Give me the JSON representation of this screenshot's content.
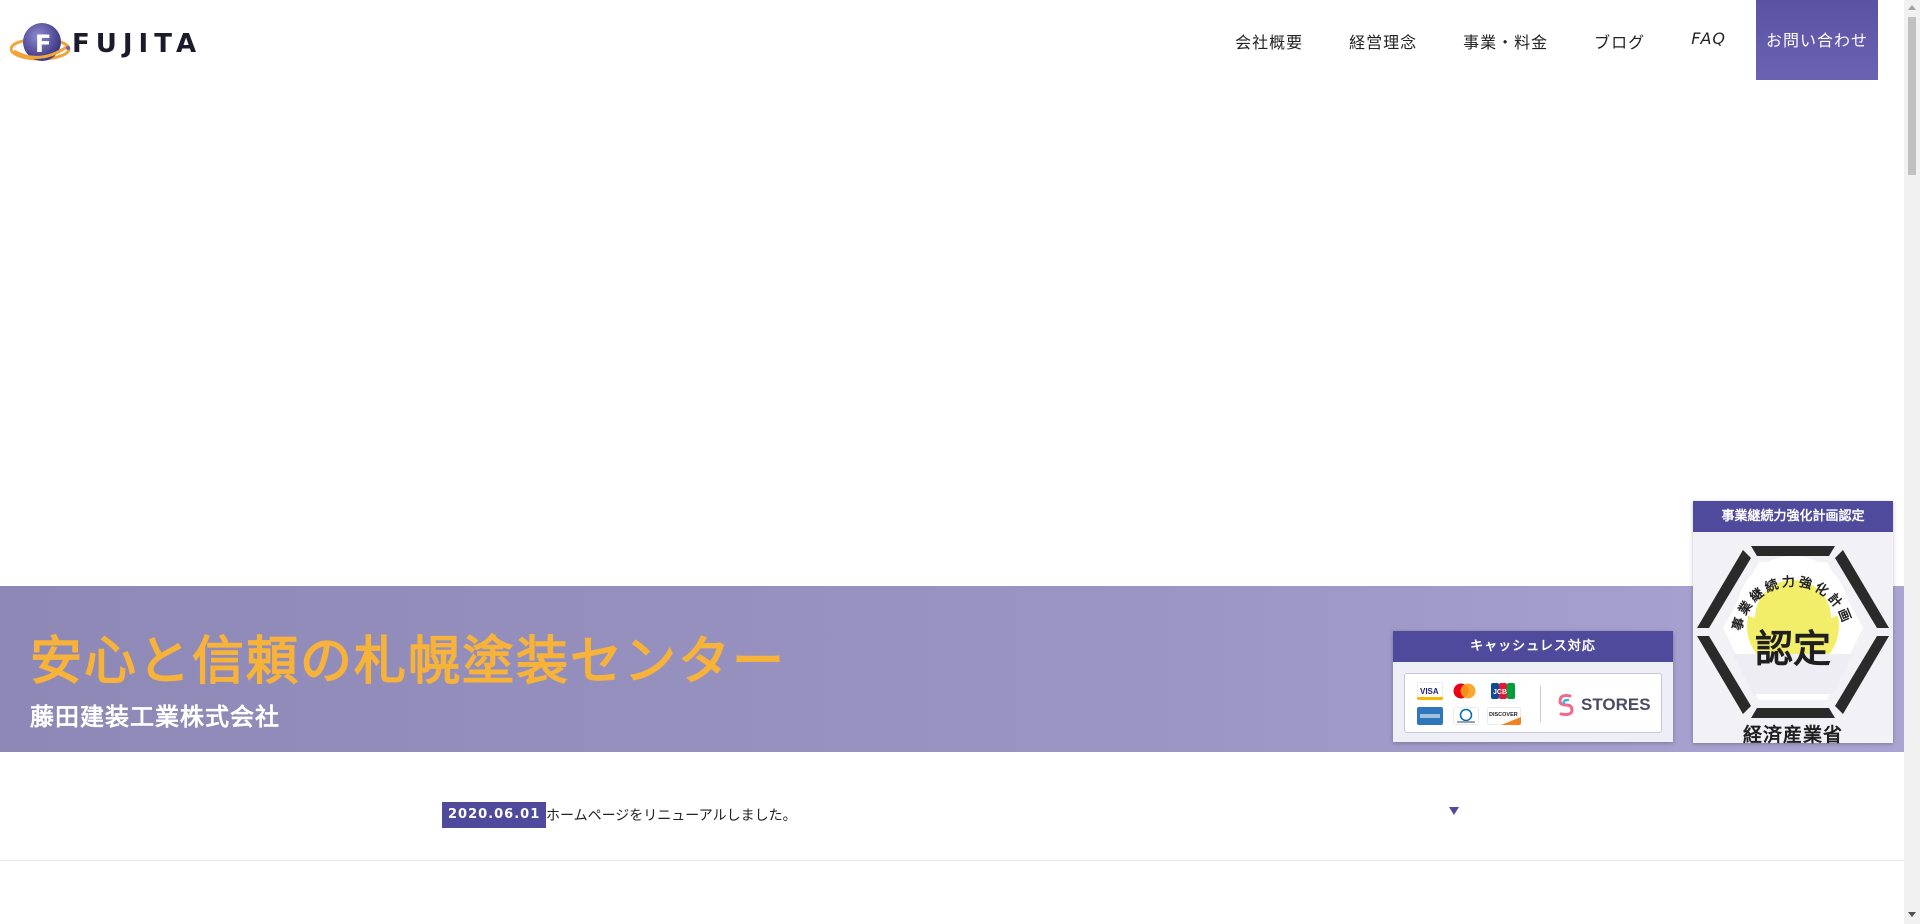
{
  "header": {
    "logo_text": "FUJITA",
    "logo_letter": "F",
    "nav": [
      {
        "label": "会社概要"
      },
      {
        "label": "経営理念"
      },
      {
        "label": "事業・料金"
      },
      {
        "label": "ブログ"
      },
      {
        "label": "FAQ"
      }
    ],
    "contact_label": "お問い合わせ"
  },
  "hero": {
    "title": "安心と信頼の札幌塗装センター",
    "subtitle": "藤田建装工業株式会社"
  },
  "cashless": {
    "title": "キャッシュレス対応",
    "stores_label": "STORES",
    "cards": [
      "VISA",
      "JCB",
      "DISCOVER"
    ]
  },
  "certification": {
    "title": "事業継続力強化計画認定",
    "arc_text": "事業継続力強化計画",
    "stamp": "認定",
    "footer": "経済産業省"
  },
  "news": {
    "date": "2020.06.01",
    "text": "ホームページをリニューアルしました。"
  },
  "colors": {
    "accent": "#4f4a9c",
    "hero_title": "#f7b23a",
    "hero_bg": "#9a95c2"
  }
}
